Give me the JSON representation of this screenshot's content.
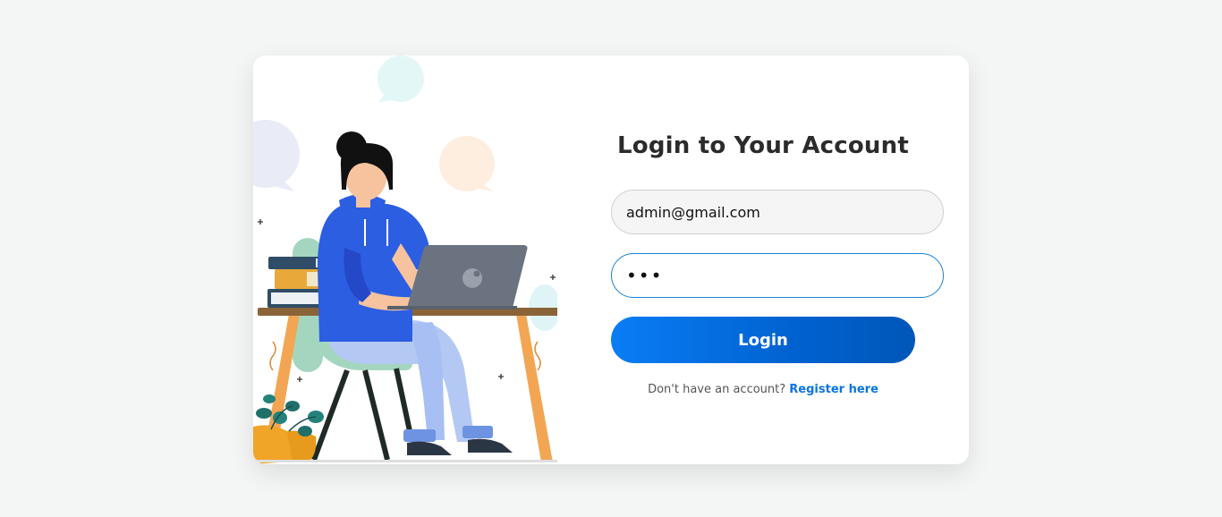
{
  "login": {
    "title": "Login to Your Account",
    "email_value": "admin@gmail.com",
    "password_value": "•••",
    "button_label": "Login",
    "register_prompt": "Don't have an account?",
    "register_link": "Register here"
  },
  "colors": {
    "page_bg": "#f4f5f5",
    "card_bg": "#ffffff",
    "accent": "#0a74e0",
    "button_gradient_start": "#0a7df5",
    "button_gradient_end": "#0057b8",
    "focus_border": "#1783d8"
  },
  "illustration": {
    "subject": "woman-working-on-laptop-icon"
  }
}
